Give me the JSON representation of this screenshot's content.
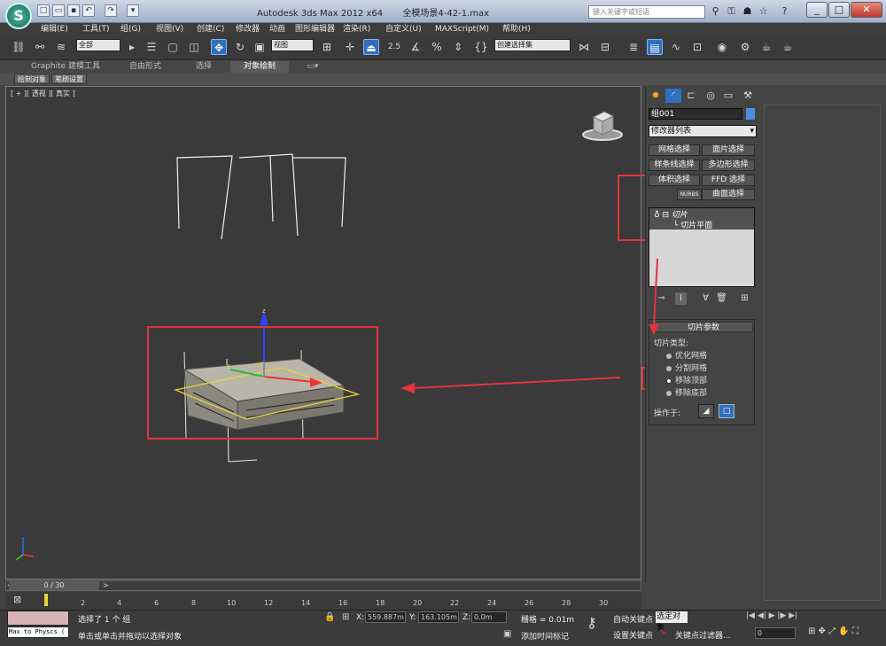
{
  "titlebar": {
    "app_title": "Autodesk 3ds Max  2012 x64",
    "file_name": "全模场景4-42-1.max",
    "search_placeholder": "键入关键字或短语",
    "quick_access_icons": [
      "new-icon",
      "open-icon",
      "save-icon",
      "undo-icon",
      "redo-icon",
      "dropdown-icon"
    ]
  },
  "menu": {
    "items": [
      "编辑(E)",
      "工具(T)",
      "组(G)",
      "视图(V)",
      "创建(C)",
      "修改器",
      "动画",
      "图形编辑器",
      "渲染(R)",
      "自定义(U)",
      "MAXScript(M)",
      "帮助(H)"
    ]
  },
  "toolbar": {
    "filter_value": "全部",
    "refcoord_value": "视图",
    "snap_value": "2.5",
    "selection_set_placeholder": "创建选择集"
  },
  "ribbon": {
    "tabs": [
      "Graphite 建模工具",
      "自由形式",
      "选择",
      "对象绘制"
    ],
    "selected_tab": 3,
    "subtabs": [
      "绘制对象",
      "笔刷设置"
    ]
  },
  "viewport": {
    "label": "[ + ][ 透视 ][ 真实 ]",
    "gizmo_axis_x": "x",
    "gizmo_axis_z": "z"
  },
  "command_panel": {
    "object_name": "组001",
    "object_color": "#4a90e2",
    "modifier_list_label": "修改器列表",
    "modifier_buttons": [
      "网格选择",
      "面片选择",
      "样条线选择",
      "多边形选择",
      "体积选择",
      "FFD 选择",
      "NURBS",
      "曲面选择"
    ],
    "stack": {
      "modifier": "切片",
      "sub_object": "切片平面"
    },
    "rollout_title": "切片参数",
    "slice_type_label": "切片类型:",
    "slice_types": [
      "优化网格",
      "分割网格",
      "移除顶部",
      "移除底部"
    ],
    "slice_type_selected": 2,
    "operate_on_label": "操作于:"
  },
  "timeline": {
    "slider_label": "0 / 30",
    "ticks": [
      "2",
      "4",
      "6",
      "8",
      "10",
      "12",
      "14",
      "16",
      "18",
      "20",
      "22",
      "24",
      "26",
      "28",
      "30"
    ]
  },
  "status": {
    "maxscript_text": "Max to Physcs (",
    "selection_status": "选择了 1 个 组",
    "prompt": "单击或单击并拖动以选择对象",
    "x_label": "X:",
    "x_value": "559.887m",
    "y_label": "Y:",
    "y_value": "163.105m",
    "z_label": "Z:",
    "z_value": "0.0m",
    "grid": "栅格 = 0.01m",
    "add_time_tag": "添加时间标记",
    "auto_key": "自动关键点",
    "selected_label": "选定对象",
    "set_key": "设置关键点",
    "key_filters": "关键点过滤器...",
    "frame_value": "0"
  }
}
